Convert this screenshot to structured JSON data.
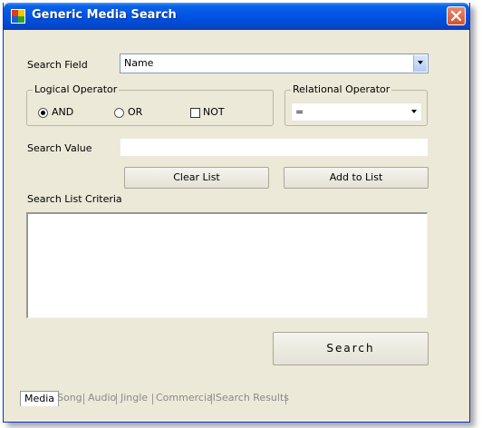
{
  "window": {
    "title": "Generic Media Search",
    "close_icon": "close-icon",
    "app_icon": "app-icon"
  },
  "search_field": {
    "label": "Search Field",
    "value": "Name"
  },
  "logical_operator": {
    "legend": "Logical Operator",
    "options": [
      {
        "label": "AND",
        "checked": true
      },
      {
        "label": "OR",
        "checked": false
      },
      {
        "label": "NOT",
        "checked": false
      }
    ]
  },
  "relational_operator": {
    "legend": "Relational Operator",
    "value": "="
  },
  "search_value": {
    "label": "Search Value",
    "value": ""
  },
  "buttons": {
    "clear": "Clear List",
    "add": "Add to List",
    "search": "Search"
  },
  "criteria": {
    "label": "Search List Criteria"
  },
  "tabs": [
    "Media",
    "Song",
    "Audio",
    "Jingle",
    "Commercial",
    "Search Results"
  ],
  "colors": {
    "titlebar": "#0055e5",
    "window_bg": "#ece9d8",
    "close_button": "#d4532f"
  }
}
